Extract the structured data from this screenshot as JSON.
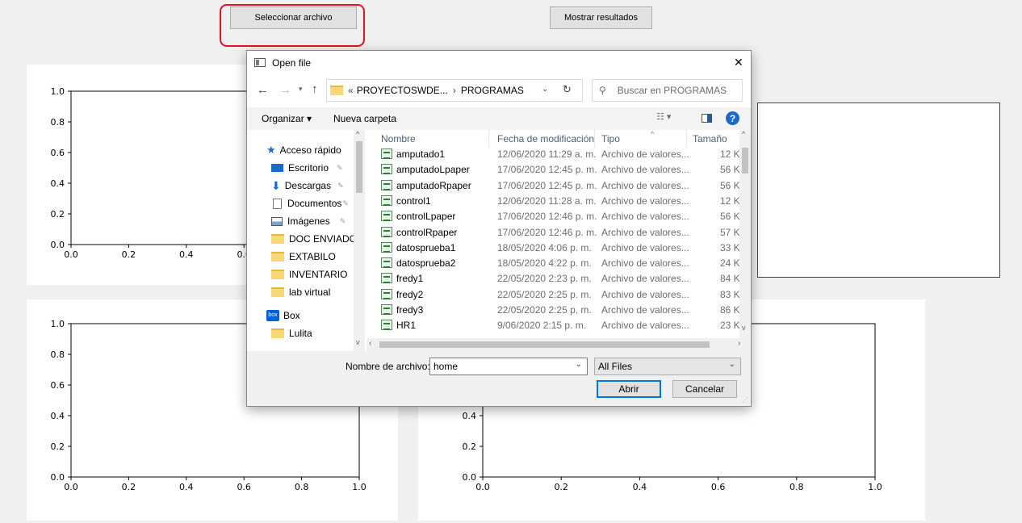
{
  "toolbar": {
    "select_file_label": "Seleccionar archivo",
    "show_results_label": "Mostrar resultados"
  },
  "plots": {
    "y_ticks": [
      "0.0",
      "0.2",
      "0.4",
      "0.6",
      "0.8",
      "1.0"
    ],
    "x_ticks": [
      "0.0",
      "0.2",
      "0.4",
      "0.6",
      "0.8",
      "1.0"
    ]
  },
  "chart_data": [
    {
      "type": "line",
      "series": [],
      "xlim": [
        0,
        1
      ],
      "ylim": [
        0,
        1
      ],
      "grid": false
    },
    {
      "type": "line",
      "series": [],
      "xlim": [
        0,
        1
      ],
      "ylim": [
        0,
        1
      ],
      "grid": false
    },
    {
      "type": "line",
      "series": [],
      "xlim": [
        0,
        1
      ],
      "ylim": [
        0,
        1
      ],
      "grid": false
    }
  ],
  "dialog": {
    "title": "Open file",
    "close_glyph": "✕",
    "breadcrumb": {
      "prefix": "«",
      "parts": [
        "PROYECTOSWDE...",
        "PROGRAMAS"
      ],
      "separator": "›"
    },
    "search_placeholder": "Buscar en PROGRAMAS",
    "organize_label": "Organizar ▾",
    "new_folder_label": "Nueva carpeta",
    "nav": {
      "quick_access": "Acceso rápido",
      "items": [
        "Escritorio",
        "Descargas",
        "Documentos",
        "Imágenes",
        "DOC ENVIADO",
        "EXTABILO",
        "INVENTARIO",
        "lab virtual"
      ],
      "box": "Box",
      "lulita": "Lulita"
    },
    "columns": {
      "name": "Nombre",
      "modified": "Fecha de modificación",
      "type": "Tipo",
      "size": "Tamaño"
    },
    "files": [
      {
        "name": "amputado1",
        "modified": "12/06/2020 11:29 a. m.",
        "type": "Archivo de valores...",
        "size": "12 K"
      },
      {
        "name": "amputadoLpaper",
        "modified": "17/06/2020 12:45 p. m.",
        "type": "Archivo de valores...",
        "size": "56 K"
      },
      {
        "name": "amputadoRpaper",
        "modified": "17/06/2020 12:45 p. m.",
        "type": "Archivo de valores...",
        "size": "56 K"
      },
      {
        "name": "control1",
        "modified": "12/06/2020 11:28 a. m.",
        "type": "Archivo de valores...",
        "size": "12 K"
      },
      {
        "name": "controlLpaper",
        "modified": "17/06/2020 12:46 p. m.",
        "type": "Archivo de valores...",
        "size": "56 K"
      },
      {
        "name": "controlRpaper",
        "modified": "17/06/2020 12:46 p. m.",
        "type": "Archivo de valores...",
        "size": "57 K"
      },
      {
        "name": "datosprueba1",
        "modified": "18/05/2020 4:06 p. m.",
        "type": "Archivo de valores...",
        "size": "33 K"
      },
      {
        "name": "datosprueba2",
        "modified": "18/05/2020 4:22 p. m.",
        "type": "Archivo de valores...",
        "size": "24 K"
      },
      {
        "name": "fredy1",
        "modified": "22/05/2020 2:23 p. m.",
        "type": "Archivo de valores...",
        "size": "84 K"
      },
      {
        "name": "fredy2",
        "modified": "22/05/2020 2:25 p. m.",
        "type": "Archivo de valores...",
        "size": "83 K"
      },
      {
        "name": "fredy3",
        "modified": "22/05/2020 2:25 p. m.",
        "type": "Archivo de valores...",
        "size": "86 K"
      },
      {
        "name": "HR1",
        "modified": "9/06/2020 2:15 p. m.",
        "type": "Archivo de valores...",
        "size": "23 K"
      }
    ],
    "filename_label": "Nombre de archivo:",
    "filename_value": "home",
    "filter_value": "All Files",
    "open_label": "Abrir",
    "cancel_label": "Cancelar"
  },
  "colors": {
    "highlight": "#e81123",
    "accent": "#0078d7"
  }
}
